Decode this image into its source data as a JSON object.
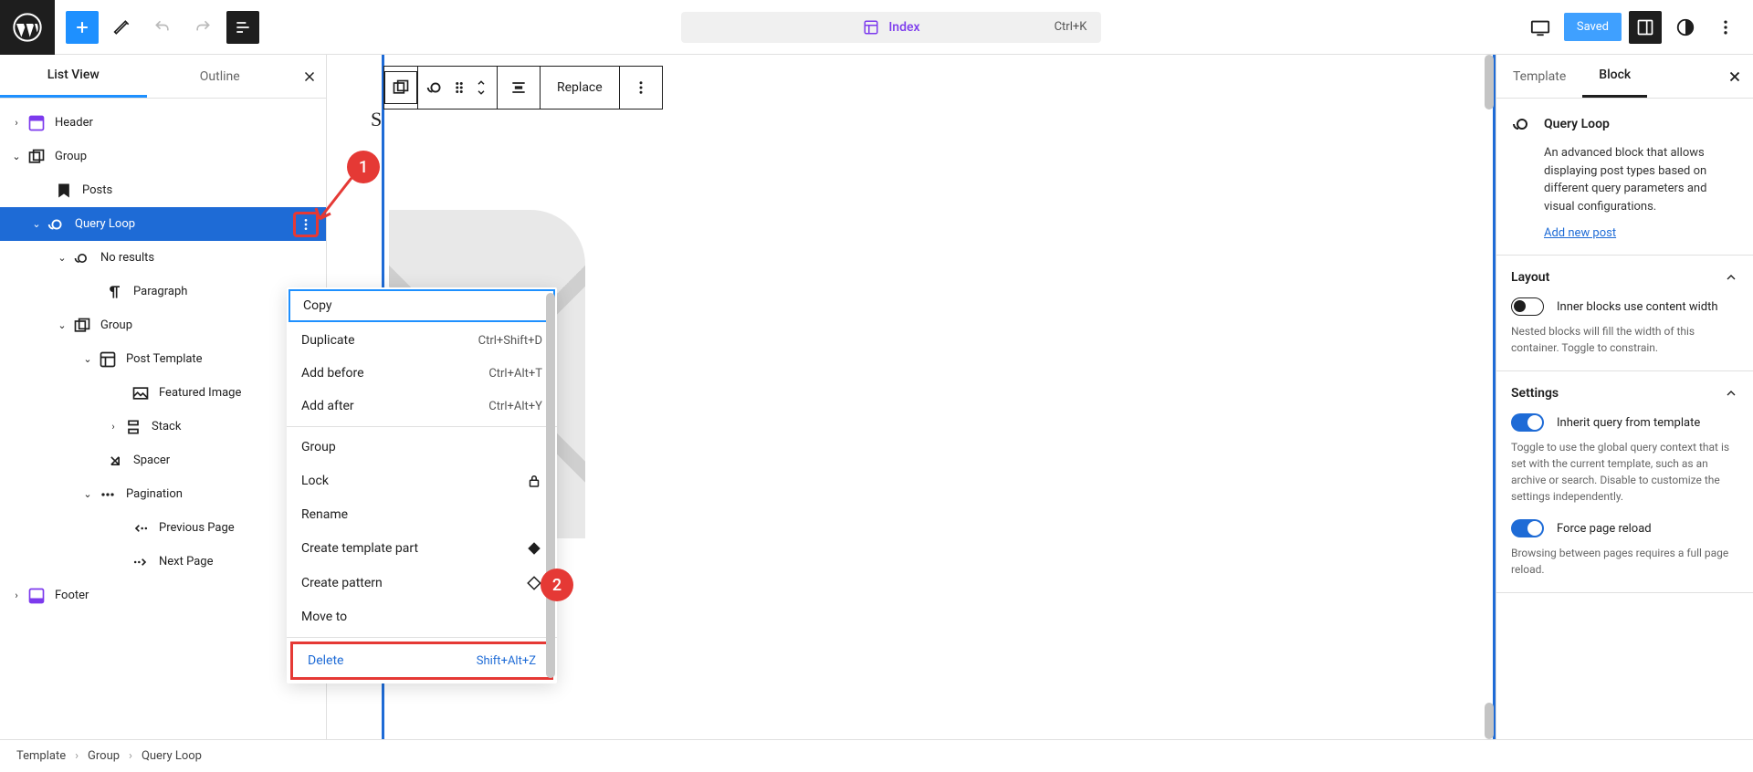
{
  "topbar": {
    "page_label": "Index",
    "shortcut": "Ctrl+K",
    "saved_label": "Saved"
  },
  "left_panel": {
    "tabs": {
      "list_view": "List View",
      "outline": "Outline"
    },
    "tree": {
      "header": "Header",
      "group": "Group",
      "posts": "Posts",
      "query_loop": "Query Loop",
      "no_results": "No results",
      "paragraph": "Paragraph",
      "group2": "Group",
      "post_template": "Post Template",
      "featured_image": "Featured Image",
      "stack": "Stack",
      "spacer": "Spacer",
      "pagination": "Pagination",
      "prev_page": "Previous Page",
      "next_page": "Next Page",
      "footer": "Footer"
    }
  },
  "context_menu": {
    "copy": "Copy",
    "duplicate": "Duplicate",
    "duplicate_sc": "Ctrl+Shift+D",
    "add_before": "Add before",
    "add_before_sc": "Ctrl+Alt+T",
    "add_after": "Add after",
    "add_after_sc": "Ctrl+Alt+Y",
    "group": "Group",
    "lock": "Lock",
    "rename": "Rename",
    "create_template_part": "Create template part",
    "create_pattern": "Create pattern",
    "move_to": "Move to",
    "delete": "Delete",
    "delete_sc": "Shift+Alt+Z"
  },
  "floating_toolbar": {
    "replace": "Replace"
  },
  "right_panel": {
    "tabs": {
      "template": "Template",
      "block": "Block"
    },
    "block_title": "Query Loop",
    "block_desc": "An advanced block that allows displaying post types based on different query parameters and visual configurations.",
    "add_new_post": "Add new post",
    "layout": {
      "title": "Layout",
      "inner_label": "Inner blocks use content width",
      "inner_help": "Nested blocks will fill the width of this container. Toggle to constrain."
    },
    "settings": {
      "title": "Settings",
      "inherit_label": "Inherit query from template",
      "inherit_help": "Toggle to use the global query context that is set with the current template, such as an archive or search. Disable to customize the settings independently.",
      "force_label": "Force page reload",
      "force_help": "Browsing between pages requires a full page reload."
    }
  },
  "breadcrumb": {
    "template": "Template",
    "group": "Group",
    "query_loop": "Query Loop"
  },
  "annotations": {
    "one": "1",
    "two": "2"
  }
}
